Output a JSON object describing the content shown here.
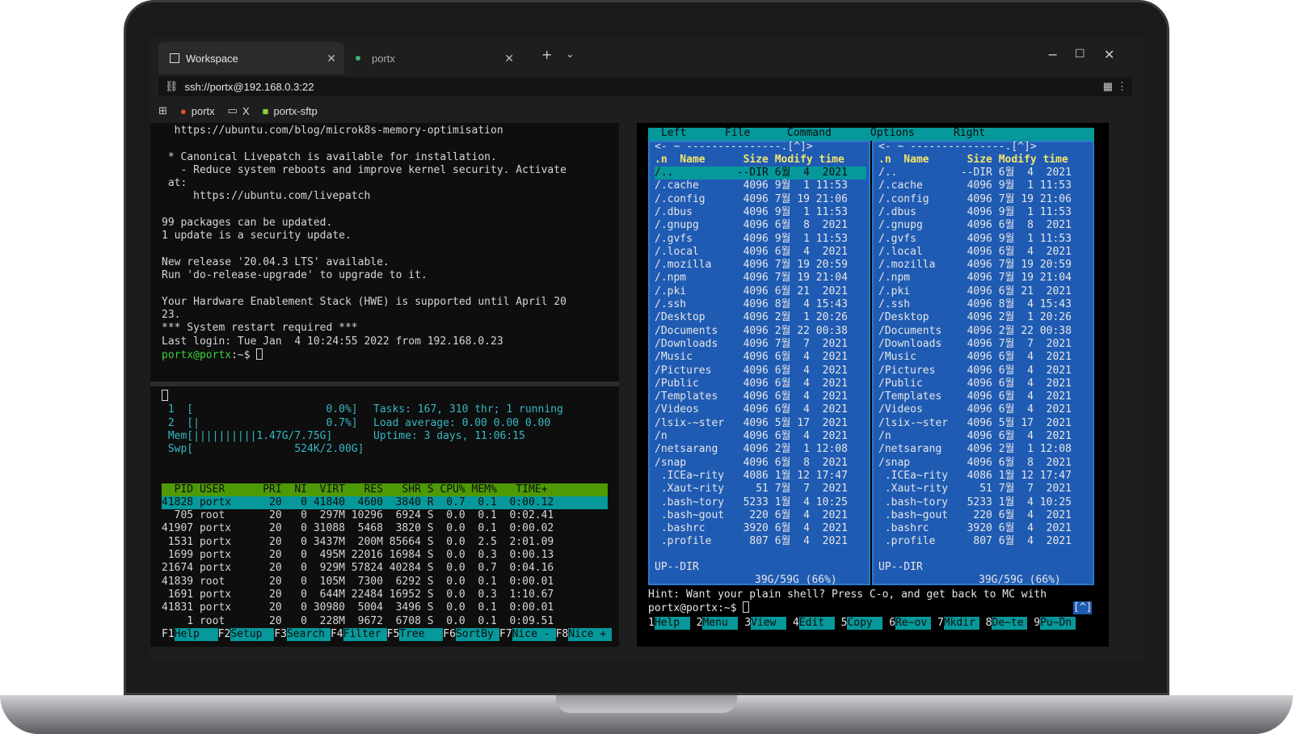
{
  "tabs": [
    {
      "label": "Workspace",
      "active": true
    },
    {
      "label": "portx",
      "active": false
    }
  ],
  "address": "ssh://portx@192.168.0.3:22",
  "bookmarks": [
    {
      "label": "portx"
    },
    {
      "label": "X"
    },
    {
      "label": "portx-sftp"
    }
  ],
  "term1": {
    "lines": [
      "  https://ubuntu.com/blog/microk8s-memory-optimisation",
      "",
      " * Canonical Livepatch is available for installation.",
      "   - Reduce system reboots and improve kernel security. Activate",
      " at:",
      "     https://ubuntu.com/livepatch",
      "",
      "99 packages can be updated.",
      "1 update is a security update.",
      "",
      "New release '20.04.3 LTS' available.",
      "Run 'do-release-upgrade' to upgrade to it.",
      "",
      "Your Hardware Enablement Stack (HWE) is supported until April 20",
      "23.",
      "*** System restart required ***",
      "Last login: Tue Jan  4 10:24:55 2022 from 192.168.0.23"
    ],
    "prompt": "portx@portx",
    "prompt_suffix": ":~$ "
  },
  "htop": {
    "meters": [
      " 1  [                     0.0%]",
      " 2  [|                    0.7%]",
      " Mem[||||||||||1.47G/7.75G]",
      " Swp[                524K/2.00G]"
    ],
    "tasks": "Tasks: 167, 310 thr; 1 running",
    "load": "Load average: 0.00 0.00 0.00",
    "uptime": "Uptime: 3 days, 11:06:15",
    "header": "  PID USER      PRI  NI  VIRT   RES   SHR S CPU% MEM%   TIME+",
    "rows": [
      "41828 portx      20   0 41840  4600  3840 R  0.7  0.1  0:00.12",
      "  705 root       20   0  297M 10296  6924 S  0.0  0.1  0:02.41",
      "41907 portx      20   0 31088  5468  3820 S  0.0  0.1  0:00.02",
      " 1531 portx      20   0 3437M  200M 85664 S  0.0  2.5  2:01.09",
      " 1699 portx      20   0  495M 22016 16984 S  0.0  0.3  0:00.13",
      "21674 portx      20   0  929M 57824 40284 S  0.0  0.7  0:04.16",
      "41839 root       20   0  105M  7300  6292 S  0.0  0.1  0:00.01",
      " 1691 portx      20   0  644M 22484 16952 S  0.0  0.3  1:10.67",
      "41831 portx      20   0 30980  5004  3496 S  0.0  0.1  0:00.01",
      "    1 root       20   0  228M  9672  6708 S  0.0  0.1  0:09.51"
    ],
    "fkeys": [
      [
        "F1",
        "Help"
      ],
      [
        "F2",
        "Setup"
      ],
      [
        "F3",
        "Search"
      ],
      [
        "F4",
        "Filter"
      ],
      [
        "F5",
        "Tree"
      ],
      [
        "F6",
        "SortBy"
      ],
      [
        "F7",
        "Nice -"
      ],
      [
        "F8",
        "Nice +"
      ]
    ]
  },
  "mc": {
    "menu": [
      "Left",
      "File",
      "Command",
      "Options",
      "Right"
    ],
    "left_top": "<- ~ ---------------.[^]>",
    "right_top": "<- ~ ---------------.[^]>",
    "col_header": ".n  Name      Size Modify time",
    "entries": [
      "/..          --DIR 6월  4  2021",
      "/.cache       4096 9월  1 11:53",
      "/.config      4096 7월 19 21:06",
      "/.dbus        4096 9월  1 11:53",
      "/.gnupg       4096 6월  8  2021",
      "/.gvfs        4096 9월  1 11:53",
      "/.local       4096 6월  4  2021",
      "/.mozilla     4096 7월 19 20:59",
      "/.npm         4096 7월 19 21:04",
      "/.pki         4096 6월 21  2021",
      "/.ssh         4096 8월  4 15:43",
      "/Desktop      4096 2월  1 20:26",
      "/Documents    4096 2월 22 00:38",
      "/Downloads    4096 7월  7  2021",
      "/Music        4096 6월  4  2021",
      "/Pictures     4096 6월  4  2021",
      "/Public       4096 6월  4  2021",
      "/Templates    4096 6월  4  2021",
      "/Videos       4096 6월  4  2021",
      "/lsix-~ster   4096 5월 17  2021",
      "/n            4096 6월  4  2021",
      "/netsarang    4096 2월  1 12:08",
      "/snap         4096 6월  8  2021",
      " .ICEa~rity   4086 1월 12 17:47",
      " .Xaut~rity     51 7월  7  2021",
      " .bash~tory   5233 1월  4 10:25",
      " .bash~gout    220 6월  4  2021",
      " .bashrc      3920 6월  4  2021",
      " .profile      807 6월  4  2021"
    ],
    "status": "UP--DIR",
    "disk": "39G/59G (66%)",
    "hint": "Hint: Want your plain shell? Press C-o, and get back to MC with",
    "prompt": "portx@portx:~$ ",
    "corner": "[^]",
    "fkeys": [
      [
        "1",
        "Help"
      ],
      [
        "2",
        "Menu"
      ],
      [
        "3",
        "View"
      ],
      [
        "4",
        "Edit"
      ],
      [
        "5",
        "Copy"
      ],
      [
        "6",
        "Re~ov"
      ],
      [
        "7",
        "Mkdir"
      ],
      [
        "8",
        "De~te"
      ],
      [
        "9",
        "Pu~Dn"
      ]
    ]
  }
}
